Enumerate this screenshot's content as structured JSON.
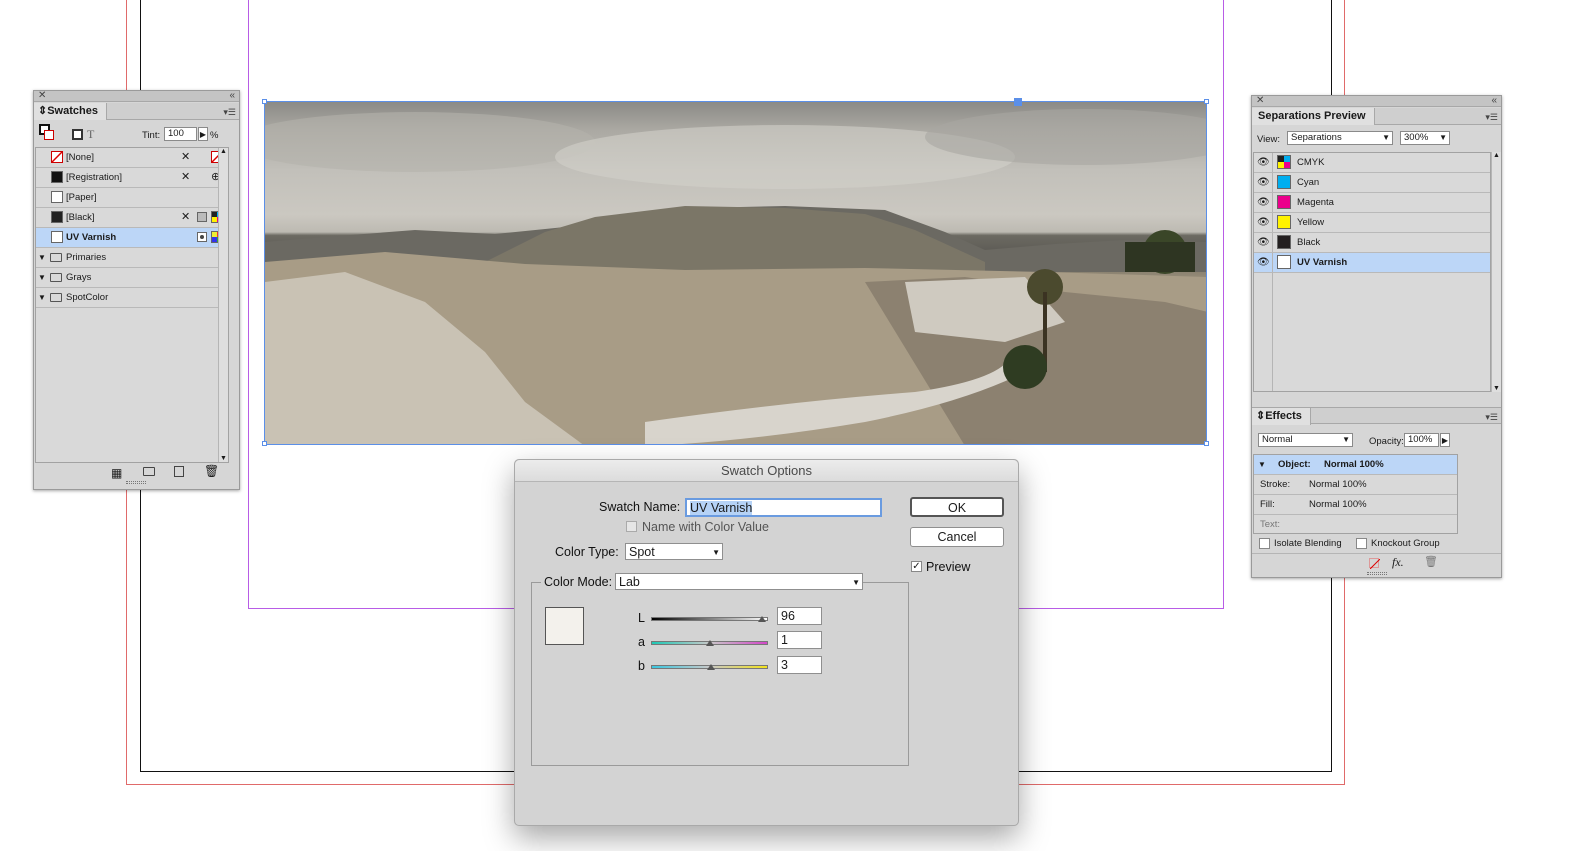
{
  "swatches": {
    "title": "Swatches",
    "tint_label": "Tint:",
    "tint_value": "100",
    "tint_unit": "%",
    "items": [
      {
        "label": "[None]",
        "color": "none"
      },
      {
        "label": "[Registration]",
        "color": "#111111"
      },
      {
        "label": "[Paper]",
        "color": "#ffffff"
      },
      {
        "label": "[Black]",
        "color": "#222222"
      },
      {
        "label": "UV Varnish",
        "color": "#ffffff",
        "selected": true
      },
      {
        "label": "Primaries",
        "folder": true
      },
      {
        "label": "Grays",
        "folder": true
      },
      {
        "label": "SpotColor",
        "folder": true
      }
    ]
  },
  "separations": {
    "title": "Separations Preview",
    "view_label": "View:",
    "view_value": "Separations",
    "zoom_value": "300%",
    "items": [
      {
        "label": "CMYK",
        "color": "cmyk"
      },
      {
        "label": "Cyan",
        "color": "#00aeef"
      },
      {
        "label": "Magenta",
        "color": "#ec008c"
      },
      {
        "label": "Yellow",
        "color": "#fff200"
      },
      {
        "label": "Black",
        "color": "#231f20"
      },
      {
        "label": "UV Varnish",
        "color": "#ffffff",
        "selected": true
      }
    ]
  },
  "effects": {
    "title": "Effects",
    "blend_mode": "Normal",
    "opacity_label": "Opacity:",
    "opacity_value": "100%",
    "rows": [
      {
        "label": "Object:",
        "value": "Normal 100%"
      },
      {
        "label": "Stroke:",
        "value": "Normal 100%"
      },
      {
        "label": "Fill:",
        "value": "Normal 100%"
      },
      {
        "label": "Text:",
        "value": ""
      }
    ],
    "isolate_label": "Isolate Blending",
    "knockout_label": "Knockout Group"
  },
  "dialog": {
    "title": "Swatch Options",
    "name_label": "Swatch Name:",
    "name_value": "UV Varnish",
    "name_with_color_label": "Name with Color Value",
    "color_type_label": "Color Type:",
    "color_type_value": "Spot",
    "color_mode_label": "Color Mode:",
    "color_mode_value": "Lab",
    "L_label": "L",
    "L_value": "96",
    "a_label": "a",
    "a_value": "1",
    "b_label": "b",
    "b_value": "3",
    "ok_label": "OK",
    "cancel_label": "Cancel",
    "preview_label": "Preview",
    "preview_checked": true,
    "swatch_color": "#f3f1ec"
  }
}
